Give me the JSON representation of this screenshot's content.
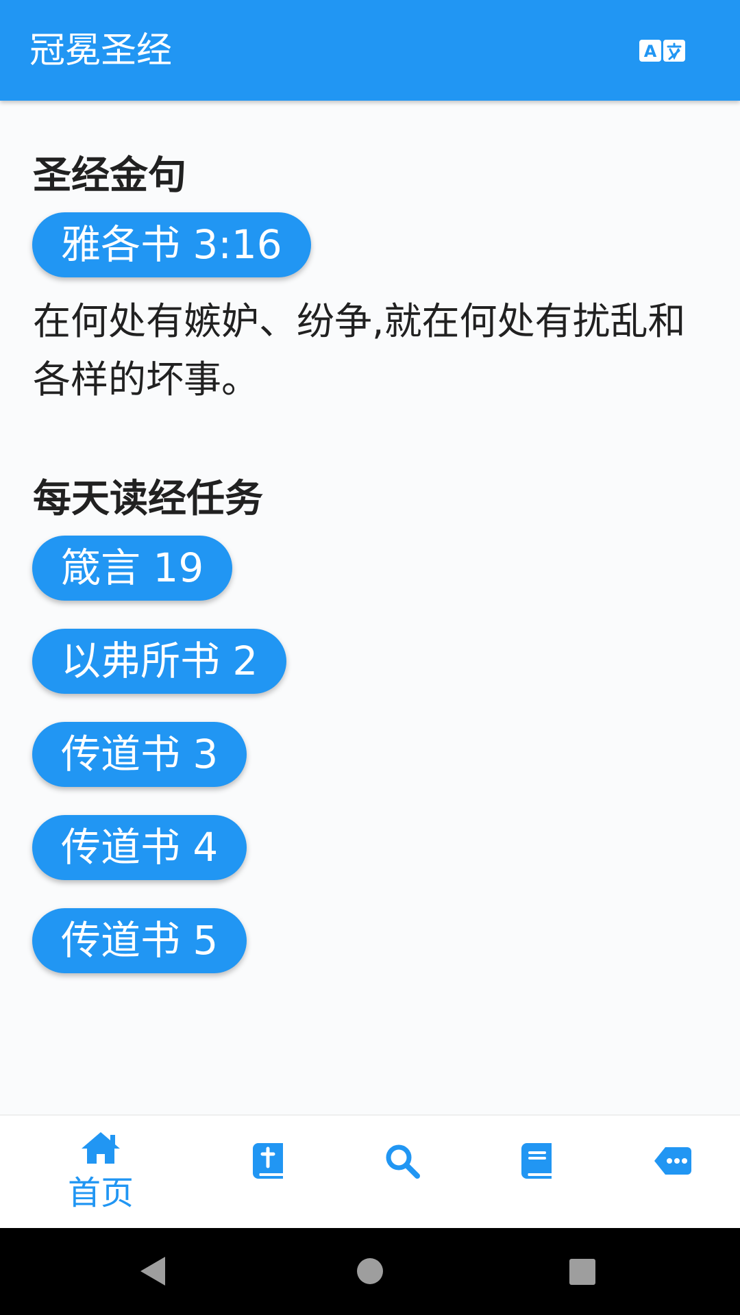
{
  "app": {
    "title": "冠冕圣经",
    "brand_color": "#2196f3"
  },
  "header": {
    "translate_icon": "translate-icon"
  },
  "golden_verse": {
    "title": "圣经金句",
    "reference": "雅各书 3:16",
    "text": "在何处有嫉妒、纷争,就在何处有扰乱和各样的坏事。"
  },
  "daily_reading": {
    "title": "每天读经任务",
    "items": [
      {
        "label": "箴言 19"
      },
      {
        "label": "以弗所书 2"
      },
      {
        "label": "传道书 3"
      },
      {
        "label": "传道书 4"
      },
      {
        "label": "传道书 5"
      }
    ]
  },
  "bottom_nav": {
    "items": [
      {
        "label": "首页",
        "icon": "home-icon",
        "active": true
      },
      {
        "label": "",
        "icon": "bible-icon",
        "active": false
      },
      {
        "label": "",
        "icon": "search-icon",
        "active": false
      },
      {
        "label": "",
        "icon": "book-icon",
        "active": false
      },
      {
        "label": "",
        "icon": "more-icon",
        "active": false
      }
    ]
  },
  "system_nav": {
    "back_icon": "back-icon",
    "home_icon": "home-circle-icon",
    "recents_icon": "recents-icon"
  }
}
